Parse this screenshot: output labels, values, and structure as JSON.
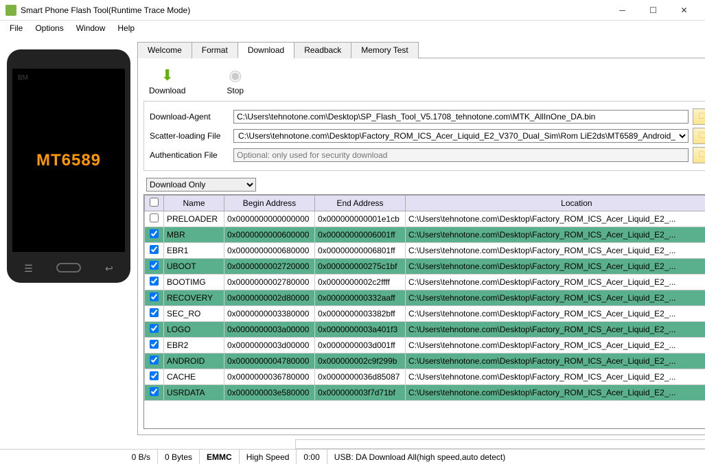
{
  "window": {
    "title": "Smart Phone Flash Tool(Runtime Trace Mode)"
  },
  "menu": [
    "File",
    "Options",
    "Window",
    "Help"
  ],
  "phone": {
    "bm": "BM",
    "chip": "MT6589"
  },
  "tabs": [
    "Welcome",
    "Format",
    "Download",
    "Readback",
    "Memory Test"
  ],
  "activeTab": 2,
  "toolbar": {
    "download": "Download",
    "stop": "Stop"
  },
  "fields": {
    "da_label": "Download-Agent",
    "da_value": "C:\\Users\\tehnotone.com\\Desktop\\SP_Flash_Tool_V5.1708_tehnotone.com\\MTK_AllInOne_DA.bin",
    "scatter_label": "Scatter-loading File",
    "scatter_value": "C:\\Users\\tehnotone.com\\Desktop\\Factory_ROM_ICS_Acer_Liquid_E2_V370_Dual_Sim\\Rom LiE2ds\\MT6589_Android_",
    "auth_label": "Authentication File",
    "auth_placeholder": "Optional: only used for security download",
    "choose": "choose"
  },
  "mode": "Download Only",
  "table": {
    "headers": [
      "",
      "Name",
      "Begin Address",
      "End Address",
      "Location"
    ],
    "rows": [
      {
        "chk": false,
        "green": false,
        "name": "PRELOADER",
        "begin": "0x0000000000000000",
        "end": "0x000000000001e1cb",
        "loc": "C:\\Users\\tehnotone.com\\Desktop\\Factory_ROM_ICS_Acer_Liquid_E2_..."
      },
      {
        "chk": true,
        "green": true,
        "name": "MBR",
        "begin": "0x0000000000600000",
        "end": "0x00000000006001ff",
        "loc": "C:\\Users\\tehnotone.com\\Desktop\\Factory_ROM_ICS_Acer_Liquid_E2_..."
      },
      {
        "chk": true,
        "green": false,
        "name": "EBR1",
        "begin": "0x0000000000680000",
        "end": "0x00000000006801ff",
        "loc": "C:\\Users\\tehnotone.com\\Desktop\\Factory_ROM_ICS_Acer_Liquid_E2_..."
      },
      {
        "chk": true,
        "green": true,
        "name": "UBOOT",
        "begin": "0x0000000002720000",
        "end": "0x000000000275c1bf",
        "loc": "C:\\Users\\tehnotone.com\\Desktop\\Factory_ROM_ICS_Acer_Liquid_E2_..."
      },
      {
        "chk": true,
        "green": false,
        "name": "BOOTIMG",
        "begin": "0x0000000002780000",
        "end": "0x0000000002c2ffff",
        "loc": "C:\\Users\\tehnotone.com\\Desktop\\Factory_ROM_ICS_Acer_Liquid_E2_..."
      },
      {
        "chk": true,
        "green": true,
        "name": "RECOVERY",
        "begin": "0x0000000002d80000",
        "end": "0x000000000332aaff",
        "loc": "C:\\Users\\tehnotone.com\\Desktop\\Factory_ROM_ICS_Acer_Liquid_E2_..."
      },
      {
        "chk": true,
        "green": false,
        "name": "SEC_RO",
        "begin": "0x0000000003380000",
        "end": "0x0000000003382bff",
        "loc": "C:\\Users\\tehnotone.com\\Desktop\\Factory_ROM_ICS_Acer_Liquid_E2_..."
      },
      {
        "chk": true,
        "green": true,
        "name": "LOGO",
        "begin": "0x0000000003a00000",
        "end": "0x0000000003a401f3",
        "loc": "C:\\Users\\tehnotone.com\\Desktop\\Factory_ROM_ICS_Acer_Liquid_E2_..."
      },
      {
        "chk": true,
        "green": false,
        "name": "EBR2",
        "begin": "0x0000000003d00000",
        "end": "0x0000000003d001ff",
        "loc": "C:\\Users\\tehnotone.com\\Desktop\\Factory_ROM_ICS_Acer_Liquid_E2_..."
      },
      {
        "chk": true,
        "green": true,
        "name": "ANDROID",
        "begin": "0x0000000004780000",
        "end": "0x000000002c9f299b",
        "loc": "C:\\Users\\tehnotone.com\\Desktop\\Factory_ROM_ICS_Acer_Liquid_E2_..."
      },
      {
        "chk": true,
        "green": false,
        "name": "CACHE",
        "begin": "0x0000000036780000",
        "end": "0x0000000036d85087",
        "loc": "C:\\Users\\tehnotone.com\\Desktop\\Factory_ROM_ICS_Acer_Liquid_E2_..."
      },
      {
        "chk": true,
        "green": true,
        "name": "USRDATA",
        "begin": "0x000000003e580000",
        "end": "0x000000003f7d71bf",
        "loc": "C:\\Users\\tehnotone.com\\Desktop\\Factory_ROM_ICS_Acer_Liquid_E2_..."
      }
    ]
  },
  "status": {
    "speed": "0 B/s",
    "bytes": "0 Bytes",
    "storage": "EMMC",
    "mode": "High Speed",
    "time": "0:00",
    "usb": "USB: DA Download All(high speed,auto detect)"
  }
}
